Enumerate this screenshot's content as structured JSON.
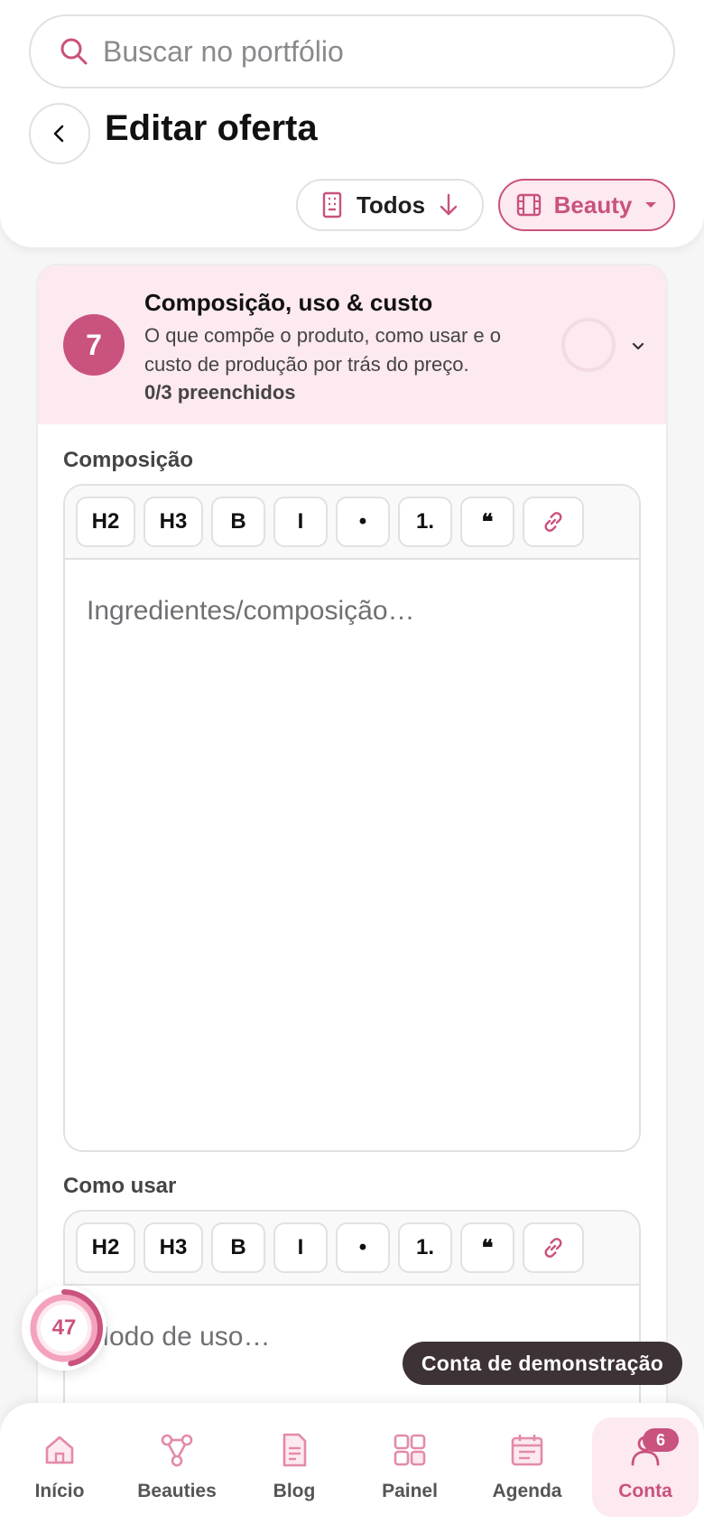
{
  "search": {
    "placeholder": "Buscar no portfólio"
  },
  "header": {
    "title": "Editar oferta",
    "filter_todos": "Todos",
    "filter_beauty": "Beauty"
  },
  "section": {
    "step_number": "7",
    "title": "Composição, uso & custo",
    "description": "O que compõe o produto, como usar e o custo de produção por trás do preço.",
    "progress_text": "0/3 preenchidos",
    "progress_fraction": 0
  },
  "toolbar": {
    "h2": "H2",
    "h3": "H3",
    "bold": "B",
    "italic": "I",
    "bullet": "•",
    "numbered": "1.",
    "quote": "❝",
    "link_icon": "link-icon"
  },
  "fields": {
    "composition": {
      "label": "Composição",
      "placeholder": "Ingredientes/composição…"
    },
    "usage": {
      "label": "Como usar",
      "placeholder": "Modo de uso…"
    }
  },
  "score": {
    "value": "47",
    "fraction": 0.47
  },
  "demo_badge": "Conta de demonstração",
  "nav": {
    "items": [
      {
        "label": "Início",
        "icon": "home-icon"
      },
      {
        "label": "Beauties",
        "icon": "network-icon"
      },
      {
        "label": "Blog",
        "icon": "document-icon"
      },
      {
        "label": "Painel",
        "icon": "grid-icon"
      },
      {
        "label": "Agenda",
        "icon": "calendar-icon"
      },
      {
        "label": "Conta",
        "icon": "user-icon",
        "badge": "6",
        "active": true
      }
    ]
  },
  "colors": {
    "accent": "#c9527e",
    "accent_soft": "#fde9f0",
    "accent_light": "#f4a3bd",
    "pill_dark": "#3d3236"
  }
}
